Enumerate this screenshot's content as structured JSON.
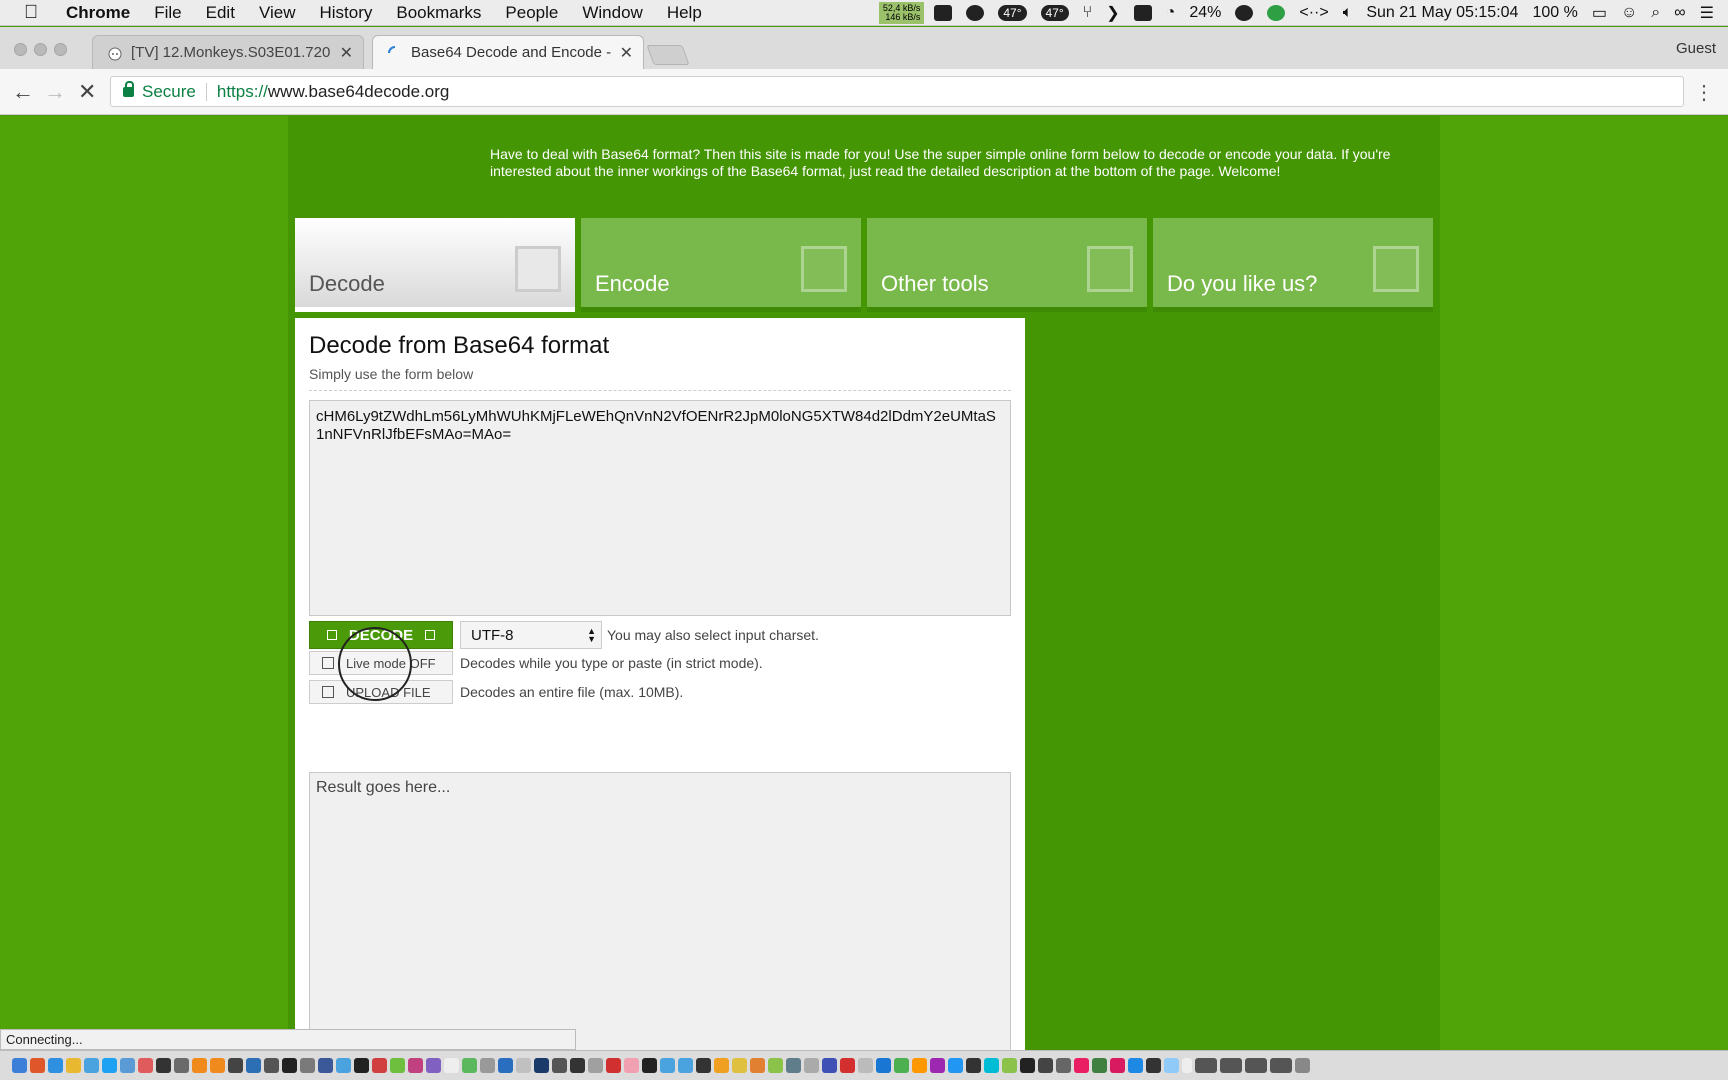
{
  "menubar": {
    "app_name": "Chrome",
    "items": [
      "File",
      "Edit",
      "View",
      "History",
      "Bookmarks",
      "People",
      "Window",
      "Help"
    ],
    "status": {
      "net_up": "52,4 kB/s",
      "net_down": "146 kB/s",
      "temp1": "47°",
      "temp2": "47°",
      "cpu": "24%",
      "datetime": "Sun 21 May  05:15:04",
      "battery": "100 %"
    }
  },
  "tabs": [
    {
      "title": "[TV] 12.Monkeys.S03E01.720",
      "active": false
    },
    {
      "title": "Base64 Decode and Encode -",
      "active": true
    }
  ],
  "profile": "Guest",
  "toolbar": {
    "secure_label": "Secure",
    "url_scheme": "https://",
    "url_host": "www.base64decode.org"
  },
  "page": {
    "intro": "Have to deal with Base64 format? Then this site is made for you! Use the super simple online form below to decode or encode your data. If you're interested about the inner workings of the Base64 format, just read the detailed description at the bottom of the page. Welcome!",
    "nav": [
      "Decode",
      "Encode",
      "Other tools",
      "Do you like us?"
    ],
    "heading": "Decode from Base64 format",
    "subheading": "Simply use the form below",
    "input_value": "cHM6Ly9tZWdhLm56LyMhWUhKMjFLeWEhQnVnN2VfOENrR2JpM0loNG5XTW84d2lDdmY2eUMtaS1nNFVnRlJfbEFsMAo=MAo=",
    "decode_label": "DECODE",
    "charset": "UTF-8",
    "charset_note": "You may also select input charset.",
    "live_mode_label": "Live mode OFF",
    "live_mode_note": "Decodes while you type or paste (in strict mode).",
    "upload_label": "UPLOAD FILE",
    "upload_note": "Decodes an entire file (max. 10MB).",
    "result_placeholder": "Result goes here..."
  },
  "statusbar": "Connecting...",
  "colors": {
    "page_green": "#50a408",
    "center_green": "#459605",
    "button_green": "#4a9a0a",
    "secure_green": "#0b8043"
  }
}
